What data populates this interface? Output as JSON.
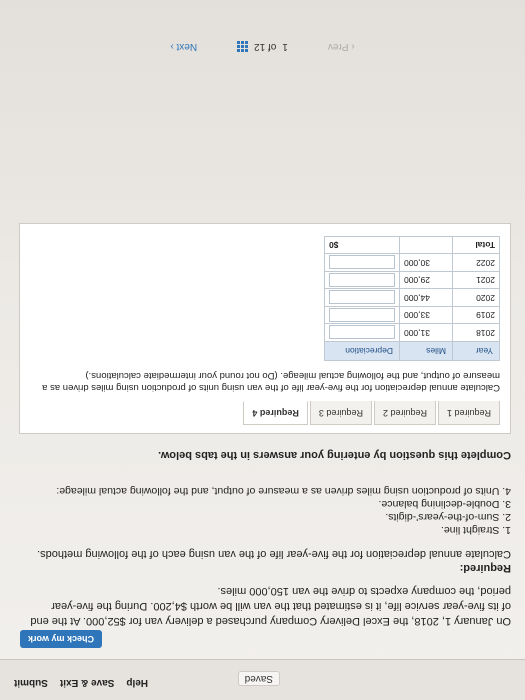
{
  "status": {
    "saved_label": "Saved"
  },
  "toolbar": {
    "help_label": "Help",
    "save_exit_label": "Save & Exit",
    "submit_label": "Submit",
    "check_work_label": "Check my work"
  },
  "problem": {
    "text": "On January 1, 2018, the Excel Delivery Company purchased a delivery van for $52,000. At the end of its five-year service life, it is estimated that the van will be worth $4,200. During the five-year period, the company expects to drive the van 150,000 miles.",
    "required_label": "Required:",
    "required_text": "Calculate annual depreciation for the five-year life of the van using each of the following methods.",
    "methods": [
      "1. Straight line.",
      "2. Sum-of-the-years'-digits.",
      "3. Double-declining balance.",
      "4. Units of production using miles driven as a measure of output, and the following actual mileage:"
    ]
  },
  "complete_note": "Complete this question by entering your answers in the tabs below.",
  "tabs": [
    {
      "label": "Required 1"
    },
    {
      "label": "Required 2"
    },
    {
      "label": "Required 3"
    },
    {
      "label": "Required 4"
    }
  ],
  "active_tab": 3,
  "instructions": "Calculate annual depreciation for the five-year life of the van using units of production using miles driven as a measure of output, and the following actual mileage. (Do not round your intermediate calculations.)",
  "table": {
    "headers": {
      "year": "Year",
      "miles": "Miles",
      "depreciation": "Depreciation"
    },
    "rows": [
      {
        "year": "2018",
        "miles": "31,000",
        "depreciation": ""
      },
      {
        "year": "2019",
        "miles": "33,000",
        "depreciation": ""
      },
      {
        "year": "2020",
        "miles": "44,000",
        "depreciation": ""
      },
      {
        "year": "2021",
        "miles": "29,000",
        "depreciation": ""
      },
      {
        "year": "2022",
        "miles": "30,000",
        "depreciation": ""
      }
    ],
    "total": {
      "label": "Total",
      "currency": "$",
      "value": "0"
    }
  },
  "nav": {
    "prev_label": "Prev",
    "page_current": "1",
    "page_of": "of 12",
    "next_label": "Next"
  }
}
